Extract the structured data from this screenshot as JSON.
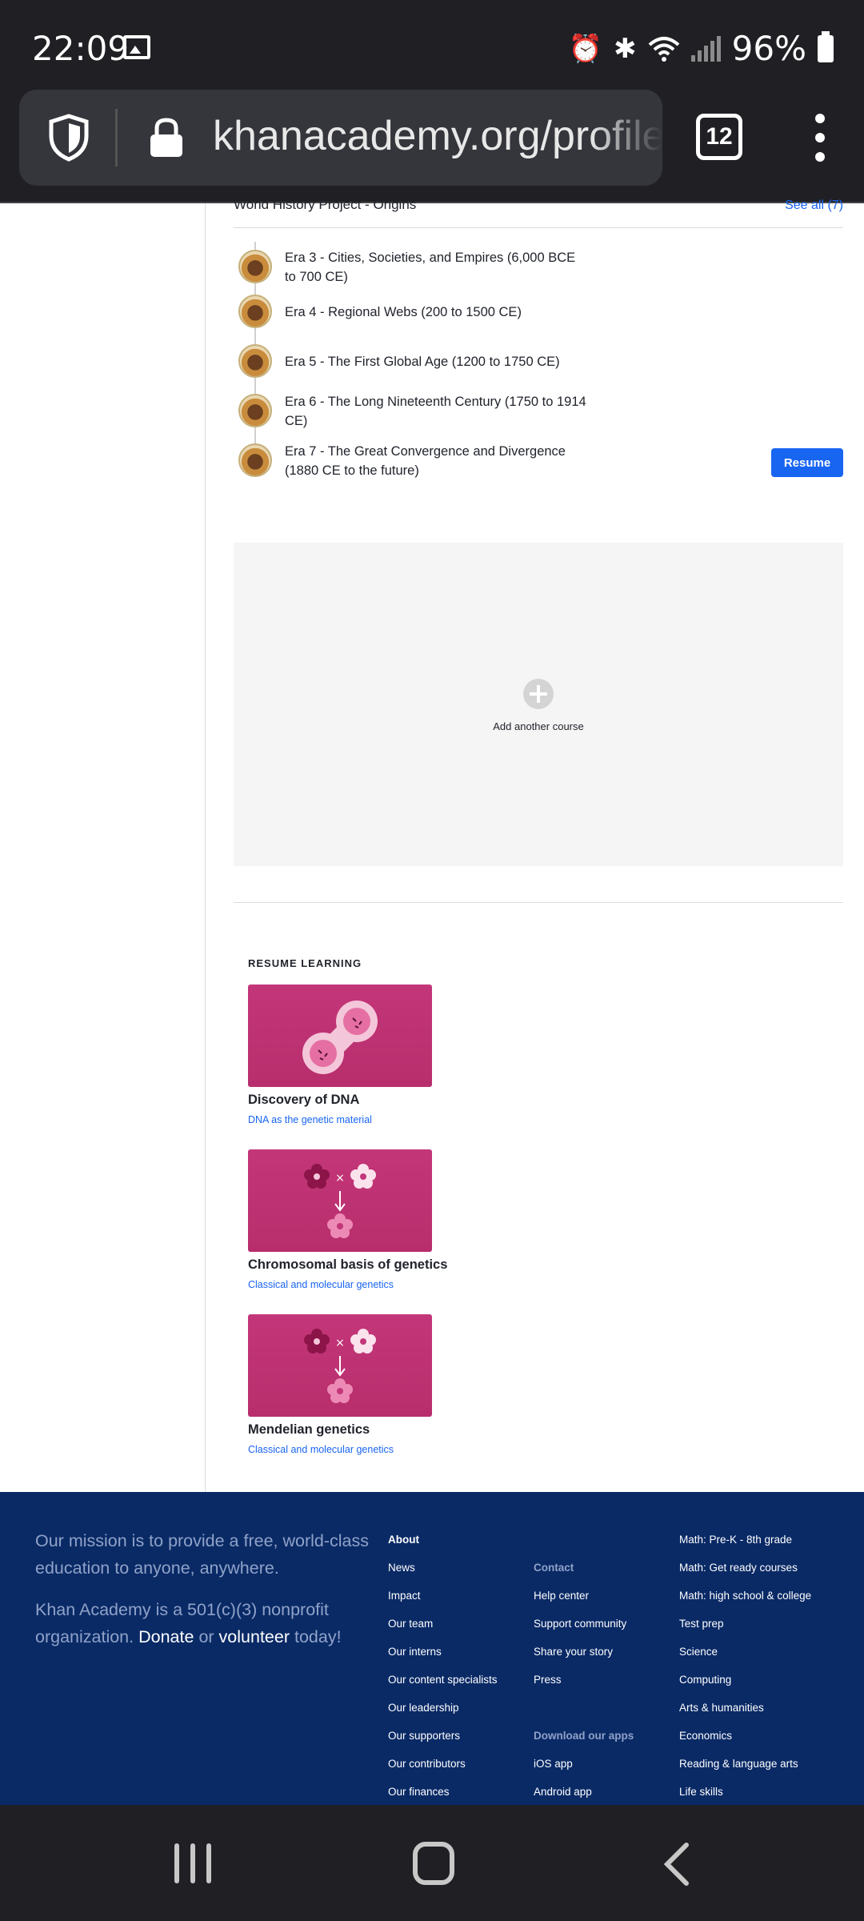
{
  "status_bar": {
    "time": "22:09",
    "battery": "96%",
    "icons": [
      "gallery-icon",
      "alarm-icon",
      "bluetooth-icon",
      "wifi-icon",
      "signal-icon",
      "battery-icon"
    ]
  },
  "browser": {
    "url": "khanacademy.org/profile/se",
    "tab_count": "12"
  },
  "course": {
    "title": "World History Project - Origins",
    "see_all": "See all (7)",
    "units": [
      {
        "label": "Era 3 - Cities, Societies, and Empires (6,000 BCE to 700 CE)"
      },
      {
        "label": "Era 4 - Regional Webs (200 to 1500 CE)"
      },
      {
        "label": "Era 5 - The First Global Age (1200 to 1750 CE)"
      },
      {
        "label": "Era 6 - The Long Nineteenth Century (1750 to 1914 CE)"
      },
      {
        "label": "Era 7 - The Great Convergence and Divergence (1880 CE to the future)"
      }
    ],
    "resume_label": "Resume"
  },
  "add_course": {
    "label": "Add another course"
  },
  "resume_learning": {
    "heading": "RESUME LEARNING",
    "cards": [
      {
        "title": "Discovery of DNA",
        "subtitle": "DNA as the genetic material"
      },
      {
        "title": "Chromosomal basis of genetics",
        "subtitle": "Classical and molecular genetics"
      },
      {
        "title": "Mendelian genetics",
        "subtitle": "Classical and molecular genetics"
      }
    ]
  },
  "footer": {
    "mission_1": "Our mission is to provide a free, world-class education to anyone, anywhere.",
    "mission_2_pre": "Khan Academy is a 501(c)(3) nonprofit organization.",
    "donate": "Donate",
    "or": "or",
    "volunteer": "volunteer",
    "today": "today!",
    "about": {
      "heading": "About",
      "items": [
        "News",
        "Impact",
        "Our team",
        "Our interns",
        "Our content specialists",
        "Our leadership",
        "Our supporters",
        "Our contributors",
        "Our finances"
      ]
    },
    "contact": {
      "heading": "Contact",
      "items": [
        "Help center",
        "Support community",
        "Share your story",
        "Press"
      ]
    },
    "apps": {
      "heading": "Download our apps",
      "items": [
        "iOS app",
        "Android app"
      ]
    },
    "subjects": {
      "items": [
        "Math: Pre-K - 8th grade",
        "Math: Get ready courses",
        "Math: high school & college",
        "Test prep",
        "Science",
        "Computing",
        "Arts & humanities",
        "Economics",
        "Reading & language arts",
        "Life skills"
      ]
    }
  },
  "colors": {
    "accent": "#1865f2",
    "footer_bg": "#0a2a66",
    "card_bg": "#c33679"
  }
}
